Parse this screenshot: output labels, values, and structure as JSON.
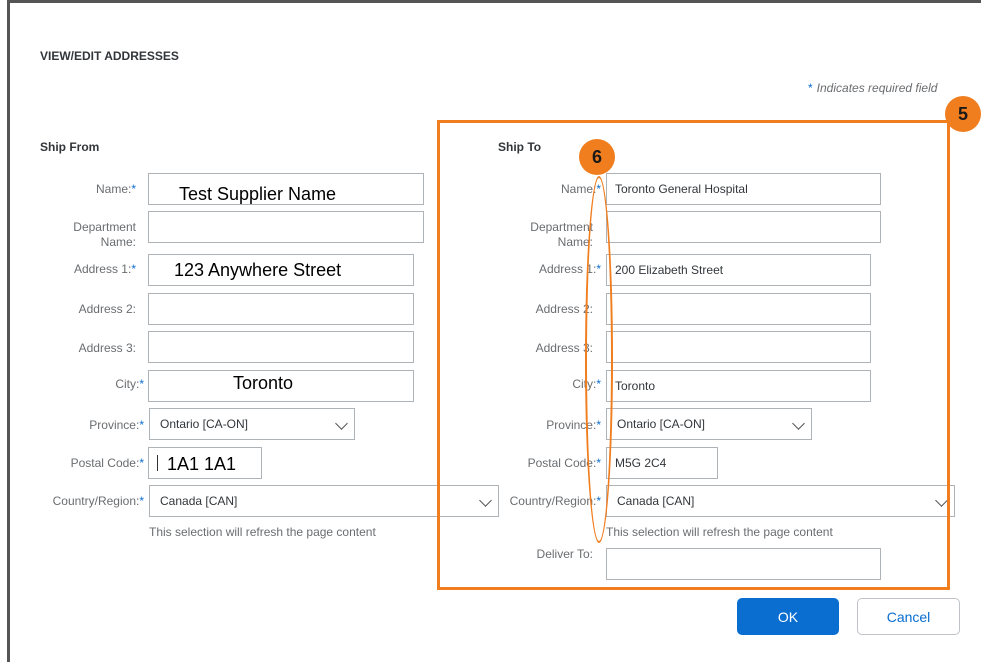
{
  "page_title": "VIEW/EDIT ADDRESSES",
  "required_note": {
    "star": "*",
    "text": "Indicates required field"
  },
  "ship_from": {
    "title": "Ship From",
    "labels": {
      "name": "Name:",
      "department": "Department Name:",
      "address1": "Address 1:",
      "address2": "Address 2:",
      "address3": "Address 3:",
      "city": "City:",
      "province": "Province:",
      "postal": "Postal Code:",
      "country": "Country/Region:"
    },
    "values": {
      "name": "Test Supplier Name",
      "department": "",
      "address1": "123 Anywhere Street",
      "address2": "",
      "address3": "",
      "city": "Toronto",
      "province": "Ontario  [CA-ON]",
      "postal": "1A1 1A1",
      "country": "Canada  [CAN]"
    },
    "hint": "This selection will refresh the page content"
  },
  "ship_to": {
    "title": "Ship To",
    "labels": {
      "name": "Name:",
      "department": "Department Name:",
      "address1": "Address 1:",
      "address2": "Address 2:",
      "address3": "Address 3:",
      "city": "City:",
      "province": "Province:",
      "postal": "Postal Code:",
      "country": "Country/Region:",
      "deliver_to": "Deliver To:"
    },
    "values": {
      "name": "Toronto General Hospital",
      "department": "",
      "address1": "200 Elizabeth Street",
      "address2": "",
      "address3": "",
      "city": "Toronto",
      "province": "Ontario  [CA-ON]",
      "postal": "M5G 2C4",
      "country": "Canada  [CAN]",
      "deliver_to": ""
    },
    "hint": "This selection will refresh the page content"
  },
  "required_marker": "*",
  "callouts": {
    "box_number": "5",
    "oval_number": "6"
  },
  "buttons": {
    "ok": "OK",
    "cancel": "Cancel"
  },
  "colors": {
    "accent": "#0a6ed1",
    "callout": "#f07d1e"
  }
}
